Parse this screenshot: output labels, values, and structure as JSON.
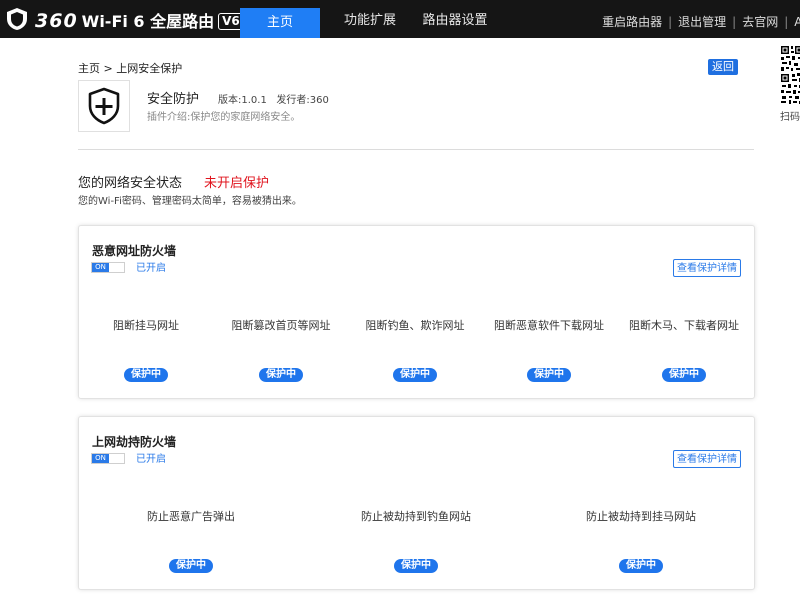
{
  "header": {
    "brand_360": "360",
    "brand_text": "Wi-Fi 6 全屋路由",
    "brand_badge": "V6",
    "tabs": [
      {
        "label": "主页",
        "active": true
      },
      {
        "label": "功能扩展",
        "active": false
      },
      {
        "label": "路由器设置",
        "active": false
      }
    ],
    "links": [
      "重启路由器",
      "退出管理",
      "去官网",
      "AI"
    ]
  },
  "breadcrumb": {
    "home": "主页",
    "separator": " > ",
    "current": "上网安全保护"
  },
  "back_button": "返回",
  "qr": {
    "label": "扫码"
  },
  "plugin": {
    "title": "安全防护",
    "version": "版本:1.0.1",
    "publisher": "发行者:360",
    "description": "插件介绍:保护您的家庭网络安全。"
  },
  "status": {
    "title": "您的网络安全状态",
    "value": "未开启保护",
    "description": "您的Wi-Fi密码、管理密码太简单，容易被猜出来。"
  },
  "cards": [
    {
      "title": "恶意网址防火墙",
      "toggle_label": "ON",
      "toggle_status": "已开启",
      "detail_button": "查看保护详情",
      "features": [
        {
          "name": "阻断挂马网址",
          "badge": "保护中"
        },
        {
          "name": "阻断篡改首页等网址",
          "badge": "保护中"
        },
        {
          "name": "阻断钓鱼、欺诈网址",
          "badge": "保护中"
        },
        {
          "name": "阻断恶意软件下载网址",
          "badge": "保护中"
        },
        {
          "name": "阻断木马、下载者网址",
          "badge": "保护中"
        }
      ]
    },
    {
      "title": "上网劫持防火墙",
      "toggle_label": "ON",
      "toggle_status": "已开启",
      "detail_button": "查看保护详情",
      "features": [
        {
          "name": "防止恶意广告弹出",
          "badge": "保护中"
        },
        {
          "name": "防止被劫持到钓鱼网站",
          "badge": "保护中"
        },
        {
          "name": "防止被劫持到挂马网站",
          "badge": "保护中"
        }
      ]
    }
  ],
  "colors": {
    "accent": "#1f7ef5",
    "header_bg": "#151515",
    "danger": "#e0141e"
  },
  "icons": {
    "logo": "shield-icon",
    "plugin": "shield-plus-icon",
    "qr": "qr-code-icon"
  }
}
